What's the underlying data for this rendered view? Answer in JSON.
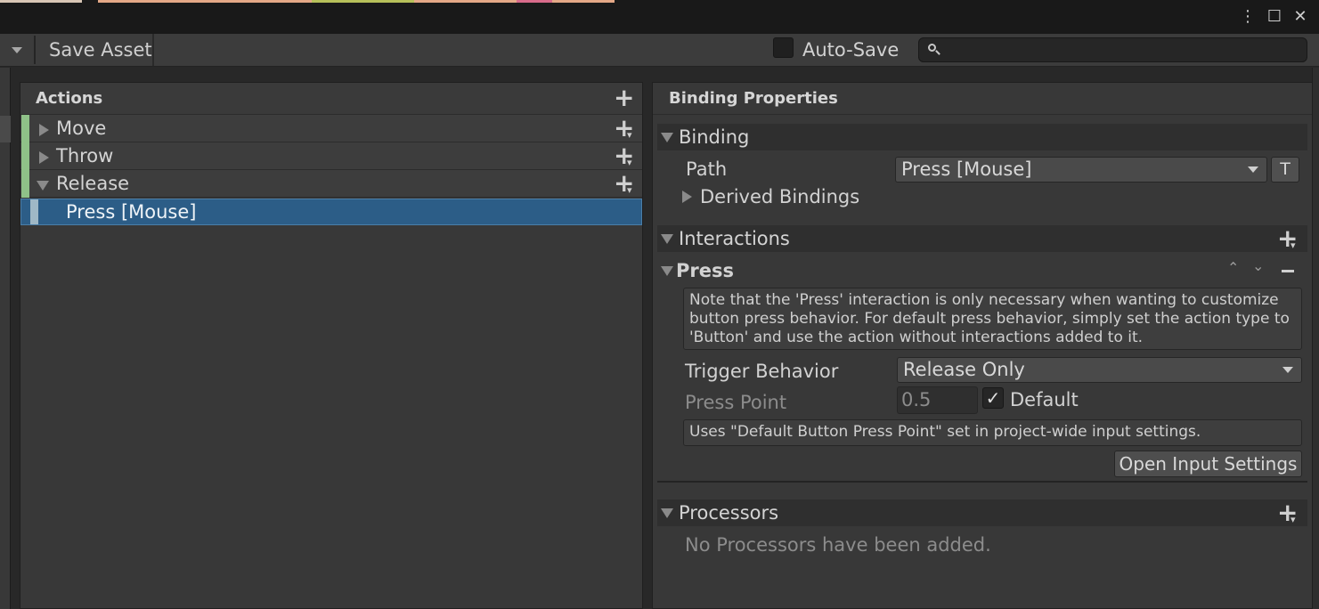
{
  "window": {
    "controls": [
      {
        "name": "kebab-menu-icon",
        "glyph": "⋮"
      },
      {
        "name": "maximize-icon",
        "glyph": "☐"
      },
      {
        "name": "close-icon",
        "glyph": "✕"
      }
    ]
  },
  "toolbar": {
    "save_label": "Save Asset",
    "autosave_label": "Auto-Save",
    "autosave_checked": false,
    "search_value": ""
  },
  "actions_panel": {
    "title": "Actions",
    "actions": [
      {
        "label": "Move",
        "expanded": false
      },
      {
        "label": "Throw",
        "expanded": false
      },
      {
        "label": "Release",
        "expanded": true
      }
    ],
    "selected_binding": "Press [Mouse]"
  },
  "binding_properties": {
    "title": "Binding Properties",
    "binding_section": {
      "label": "Binding",
      "path_label": "Path",
      "path_value": "Press [Mouse]",
      "t_button": "T",
      "derived_label": "Derived Bindings"
    },
    "interactions_section": {
      "label": "Interactions",
      "press": {
        "label": "Press",
        "note": "Note that the 'Press' interaction is only necessary when wanting to customize button press behavior. For default press behavior, simply set the action type to 'Button' and use the action without interactions added to it.",
        "trigger_label": "Trigger Behavior",
        "trigger_value": "Release Only",
        "press_point_label": "Press Point",
        "press_point_value": "0.5",
        "default_label": "Default",
        "default_checked": true,
        "hint": "Uses \"Default Button Press Point\" set in project-wide input settings.",
        "open_settings_label": "Open Input Settings"
      }
    },
    "processors_section": {
      "label": "Processors",
      "empty_text": "No Processors have been added."
    }
  },
  "colors": {
    "accent_selection": "#2c5d87",
    "action_marker": "#8fc188",
    "background": "#383838"
  }
}
